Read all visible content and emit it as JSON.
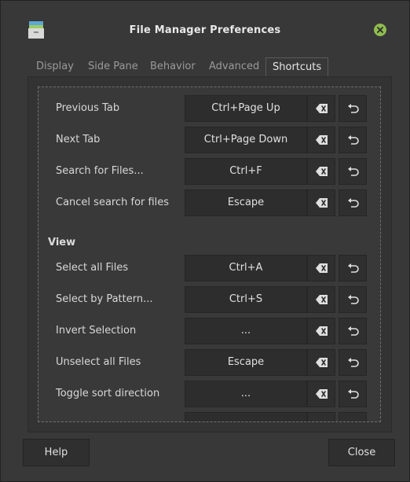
{
  "window": {
    "title": "File Manager Preferences"
  },
  "tabs": [
    {
      "label": "Display",
      "active": false
    },
    {
      "label": "Side Pane",
      "active": false
    },
    {
      "label": "Behavior",
      "active": false
    },
    {
      "label": "Advanced",
      "active": false
    },
    {
      "label": "Shortcuts",
      "active": true
    }
  ],
  "shortcuts": {
    "general": [
      {
        "label": "Previous Tab",
        "accel": "Ctrl+Page Up"
      },
      {
        "label": "Next Tab",
        "accel": "Ctrl+Page Down"
      },
      {
        "label": "Search for Files...",
        "accel": "Ctrl+F"
      },
      {
        "label": "Cancel search for files",
        "accel": "Escape"
      }
    ],
    "view_heading": "View",
    "view": [
      {
        "label": "Select all Files",
        "accel": "Ctrl+A"
      },
      {
        "label": "Select by Pattern...",
        "accel": "Ctrl+S"
      },
      {
        "label": "Invert Selection",
        "accel": "..."
      },
      {
        "label": "Unselect all Files",
        "accel": "Escape"
      },
      {
        "label": "Toggle sort direction",
        "accel": "..."
      }
    ]
  },
  "icons": {
    "clear": "edit-clear-icon",
    "reset": "undo-icon",
    "app": "file-manager-icon",
    "close": "close-icon"
  },
  "colors": {
    "close_button": "#8fbc4f",
    "background": "#383838"
  },
  "buttons": {
    "help": "Help",
    "close": "Close"
  }
}
